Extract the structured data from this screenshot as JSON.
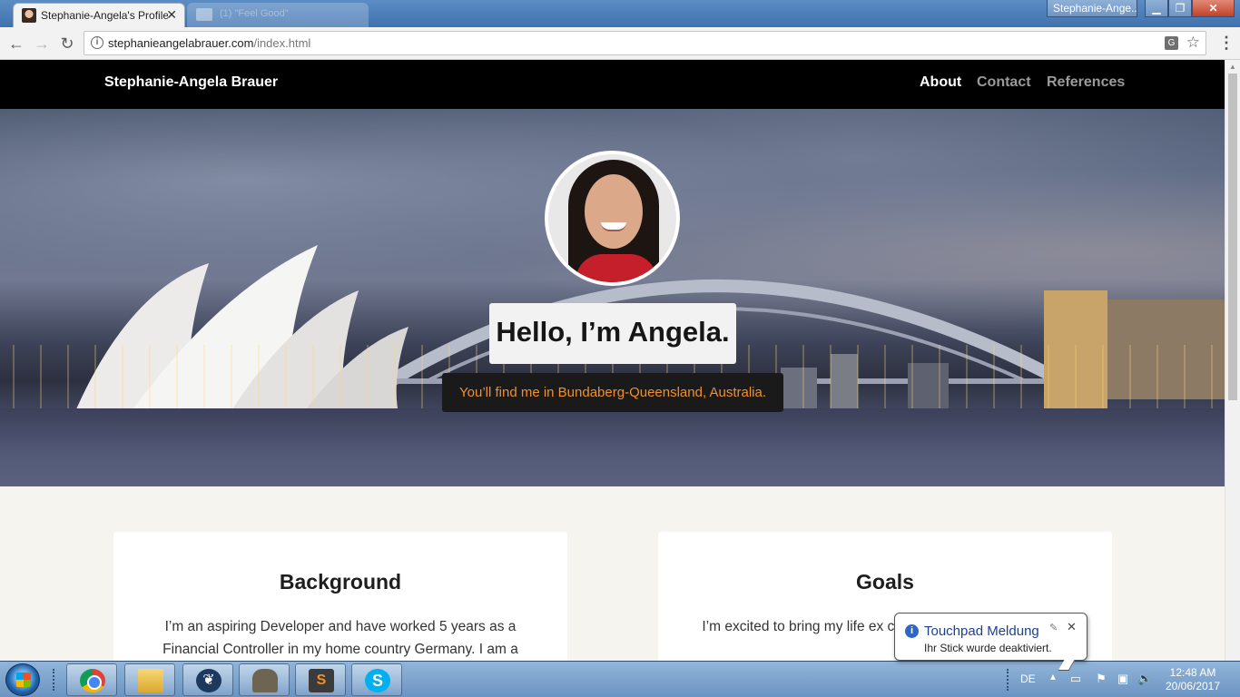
{
  "browser": {
    "active_tab_title": "Stephanie-Angela's Profile",
    "inactive_tab_title": "(1) \"Feel Good\"",
    "url_host": "stephanieangelabrauer.com",
    "url_path": "/index.html",
    "window_user": "Stephanie-Ange...",
    "icons": [
      "back-icon",
      "forward-icon",
      "reload-icon",
      "info-icon",
      "translate-icon",
      "star-icon",
      "menu-icon"
    ]
  },
  "site": {
    "brand": "Stephanie-Angela Brauer",
    "nav": [
      "About",
      "Contact",
      "References"
    ],
    "active_nav": "About",
    "hero_title": "Hello, I’m Angela.",
    "hero_subtitle": "You’ll find me in Bundaberg-Queensland, Australia.",
    "cards": [
      {
        "heading": "Background",
        "text": "I’m an aspiring Developer and have worked 5 years as a Financial Controller in my home country Germany. I am a"
      },
      {
        "heading": "Goals",
        "text": "I’m excited to bring my life ex coding beautiful interactive w"
      }
    ],
    "accent_color": "#f0902a"
  },
  "taskbar": {
    "language": "DE",
    "time": "12:48 AM",
    "date": "20/06/2017",
    "pinned": [
      "chrome-icon",
      "explorer-icon",
      "app-icon",
      "gimp-icon",
      "sublime-icon",
      "skype-icon"
    ]
  },
  "notification": {
    "title": "Touchpad Meldung",
    "message": "Ihr Stick wurde deaktiviert."
  }
}
